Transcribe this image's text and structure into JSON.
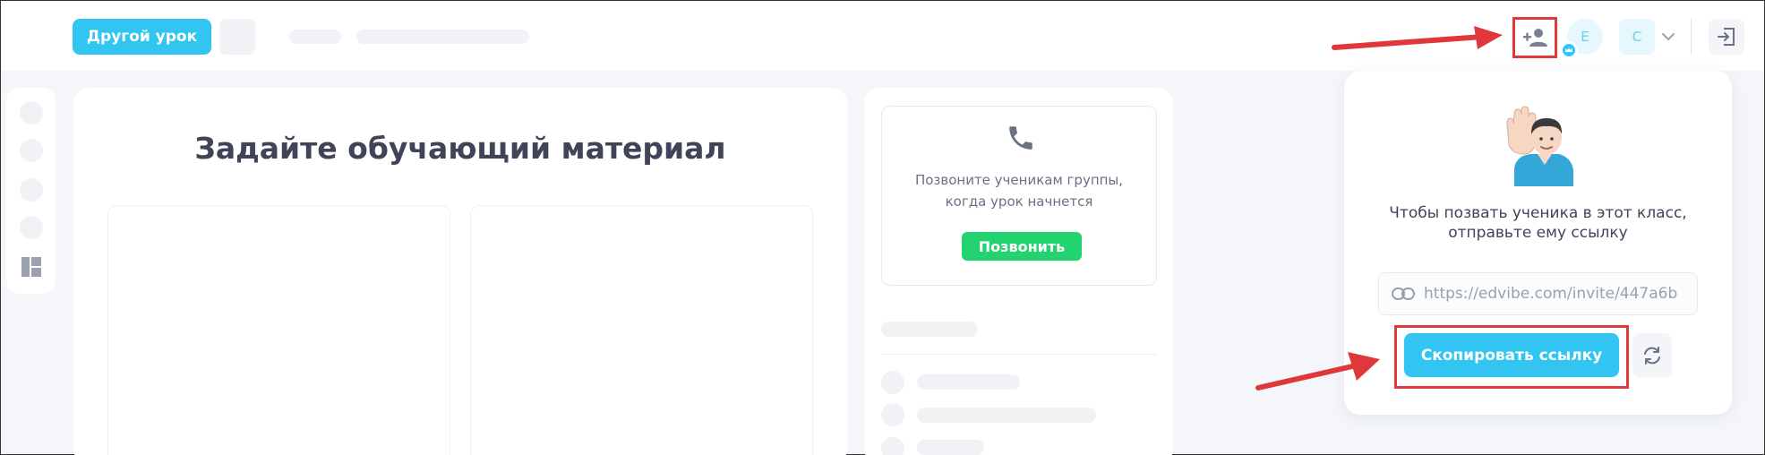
{
  "header": {
    "other_lesson_label": "Другой урок",
    "avatar_e_initial": "E",
    "avatar_c_initial": "C"
  },
  "icons": {
    "add_user": "person-add-icon",
    "crown": "crown-icon",
    "chevron": "chevron-down-icon",
    "logout": "logout-icon",
    "layout": "layout-icon",
    "phone": "phone-icon",
    "link": "link-icon",
    "refresh": "refresh-icon",
    "emoji": "raising-hand-man-emoji"
  },
  "main": {
    "title": "Задайте обучающий материал"
  },
  "call_card": {
    "text_line1": "Позвоните ученикам группы,",
    "text_line2": "когда урок начнется",
    "call_button": "Позвонить"
  },
  "invite_popover": {
    "text_line1": "Чтобы позвать ученика в этот класс,",
    "text_line2": "отправьте ему ссылку",
    "invite_link": "https://edvibe.com/invite/447a6b",
    "copy_button": "Скопировать ссылку"
  },
  "colors": {
    "accent": "#33c5f1",
    "call_green": "#22d36f",
    "highlight_red": "#e0383a",
    "text_dark": "#3f4458"
  }
}
